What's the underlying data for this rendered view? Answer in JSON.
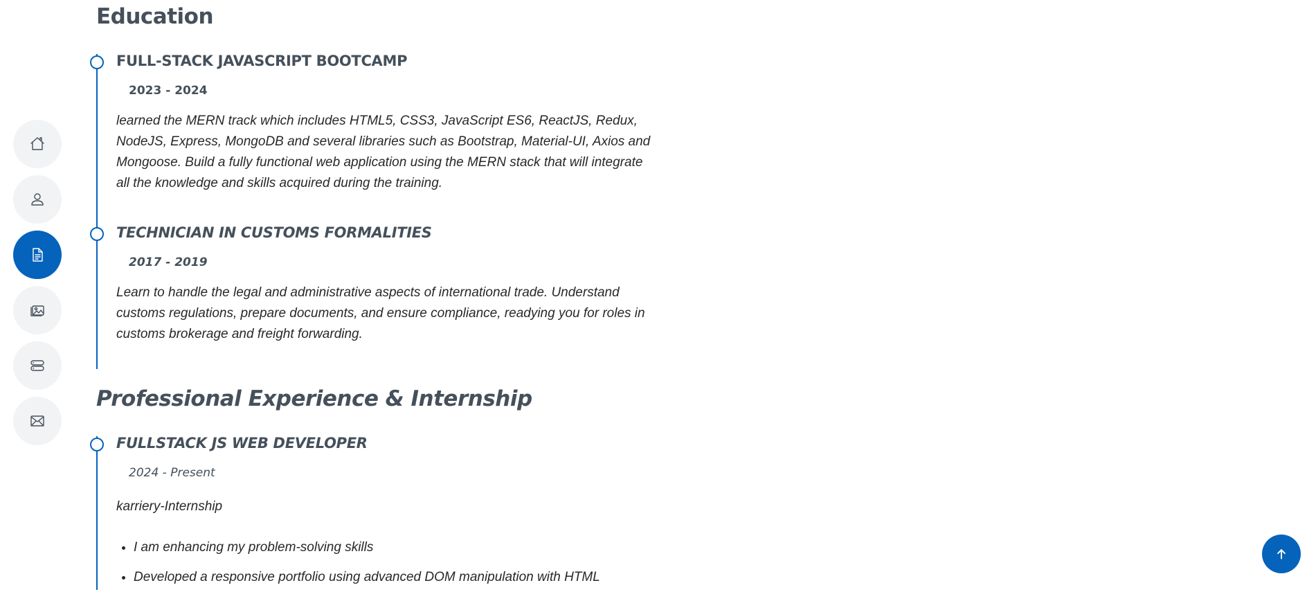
{
  "nav": {
    "items": [
      {
        "icon": "home-icon",
        "active": false
      },
      {
        "icon": "person-icon",
        "active": false
      },
      {
        "icon": "file-text-icon",
        "active": true
      },
      {
        "icon": "images-icon",
        "active": false
      },
      {
        "icon": "server-icon",
        "active": false
      },
      {
        "icon": "envelope-icon",
        "active": false
      }
    ]
  },
  "education": {
    "title": "Education",
    "items": [
      {
        "title": "FULL-STACK JAVASCRIPT BOOTCAMP",
        "date": "2023 - 2024",
        "description": "learned the MERN track which includes HTML5, CSS3, JavaScript ES6, ReactJS, Redux, NodeJS, Express, MongoDB and several libraries such as Bootstrap, Material-UI, Axios and Mongoose. Build a fully functional web application using the MERN stack that will integrate all the knowledge and skills acquired during the training."
      },
      {
        "title": "TECHNICIAN IN CUSTOMS FORMALITIES",
        "date": "2017 - 2019",
        "description": "Learn to handle the legal and administrative aspects of international trade. Understand customs regulations, prepare documents, and ensure compliance, readying you for roles in customs brokerage and freight forwarding."
      }
    ]
  },
  "experience": {
    "title": "Professional Experience & Internship",
    "items": [
      {
        "title": "FULLSTACK JS WEB DEVELOPER",
        "date": "2024 - Present",
        "company": "karriery-Internship",
        "bullets": [
          "I am enhancing my problem-solving skills",
          "Developed a responsive portfolio using advanced DOM manipulation with HTML"
        ]
      }
    ]
  },
  "colors": {
    "accent": "#0563bb",
    "heading": "#45505b",
    "text": "#272829",
    "nav_bg": "#f2f3f5"
  },
  "back_to_top": {
    "icon": "arrow-up-icon"
  }
}
